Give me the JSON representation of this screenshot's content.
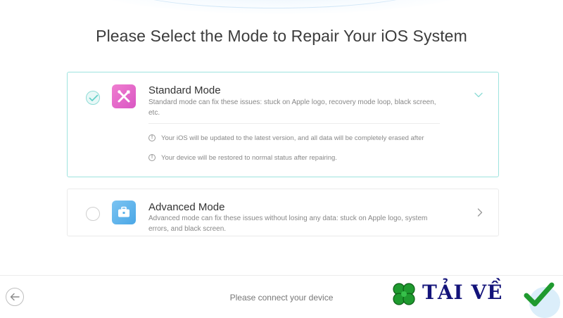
{
  "header": {
    "title": "Please Select the Mode to Repair Your iOS System"
  },
  "modes": {
    "standard": {
      "title": "Standard Mode",
      "description": "Standard mode can fix these issues: stuck on Apple logo, recovery mode loop, black screen, etc.",
      "selected": true,
      "notes": [
        "Your iOS will be updated to the latest version, and all data will be completely erased after",
        "Your device will be restored to normal status after repairing."
      ]
    },
    "advanced": {
      "title": "Advanced Mode",
      "description": "Advanced mode can fix these issues without losing any data: stuck on Apple logo, system errors, and black screen.",
      "selected": false
    }
  },
  "footer": {
    "status": "Please connect your device"
  },
  "watermark": {
    "text": "TẢI VỀ"
  },
  "icons": {
    "standard": "tools-icon",
    "advanced": "toolbox-icon",
    "back": "back-arrow-icon",
    "info": "info-icon"
  },
  "colors": {
    "accent": "#9ee3df",
    "standard_icon": "#e46acb",
    "advanced_icon": "#5bb2ea",
    "watermark_text": "#13137a",
    "watermark_green": "#1f9a2f"
  }
}
